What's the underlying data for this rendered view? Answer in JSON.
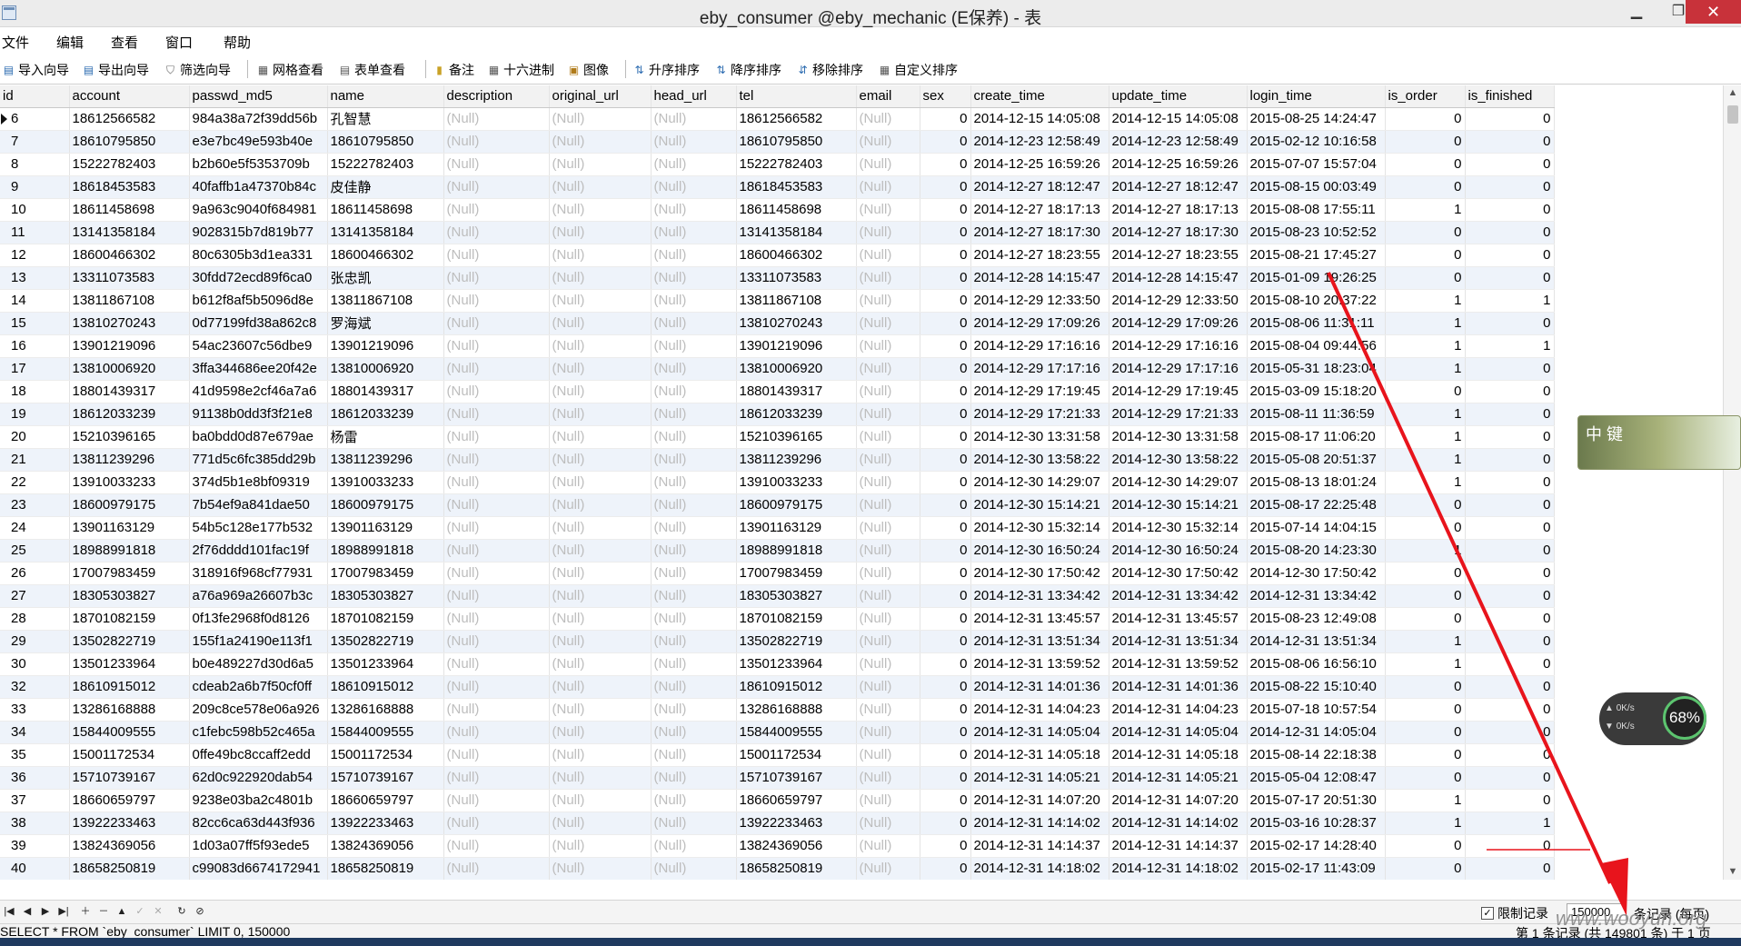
{
  "window": {
    "title": "eby_consumer @eby_mechanic (E保养) - 表"
  },
  "menu": [
    "文件",
    "编辑",
    "查看",
    "窗口",
    "帮助"
  ],
  "toolbar": [
    "导入向导",
    "导出向导",
    "筛选向导",
    "网格查看",
    "表单查看",
    "备注",
    "十六进制",
    "图像",
    "升序排序",
    "降序排序",
    "移除排序",
    "自定义排序"
  ],
  "columns": [
    "id",
    "account",
    "passwd_md5",
    "name",
    "description",
    "original_url",
    "head_url",
    "tel",
    "email",
    "sex",
    "create_time",
    "update_time",
    "login_time",
    "is_order",
    "is_finished"
  ],
  "null_text": "(Null)",
  "rows": [
    [
      "6",
      "18612566582",
      "984a38a72f39dd56b",
      "孔智慧",
      "(Null)",
      "(Null)",
      "(Null)",
      "18612566582",
      "(Null)",
      "0",
      "2014-12-15 14:05:08",
      "2014-12-15 14:05:08",
      "2015-08-25 14:24:47",
      "0",
      "0"
    ],
    [
      "7",
      "18610795850",
      "e3e7bc49e593b40e",
      "18610795850",
      "(Null)",
      "(Null)",
      "(Null)",
      "18610795850",
      "(Null)",
      "0",
      "2014-12-23 12:58:49",
      "2014-12-23 12:58:49",
      "2015-02-12 10:16:58",
      "0",
      "0"
    ],
    [
      "8",
      "15222782403",
      "b2b60e5f5353709b",
      "15222782403",
      "(Null)",
      "(Null)",
      "(Null)",
      "15222782403",
      "(Null)",
      "0",
      "2014-12-25 16:59:26",
      "2014-12-25 16:59:26",
      "2015-07-07 15:57:04",
      "0",
      "0"
    ],
    [
      "9",
      "18618453583",
      "40faffb1a47370b84c",
      "皮佳静",
      "(Null)",
      "(Null)",
      "(Null)",
      "18618453583",
      "(Null)",
      "0",
      "2014-12-27 18:12:47",
      "2014-12-27 18:12:47",
      "2015-08-15 00:03:49",
      "0",
      "0"
    ],
    [
      "10",
      "18611458698",
      "9a963c9040f684981",
      "18611458698",
      "(Null)",
      "(Null)",
      "(Null)",
      "18611458698",
      "(Null)",
      "0",
      "2014-12-27 18:17:13",
      "2014-12-27 18:17:13",
      "2015-08-08 17:55:11",
      "1",
      "0"
    ],
    [
      "11",
      "13141358184",
      "9028315b7d819b77",
      "13141358184",
      "(Null)",
      "(Null)",
      "(Null)",
      "13141358184",
      "(Null)",
      "0",
      "2014-12-27 18:17:30",
      "2014-12-27 18:17:30",
      "2015-08-23 10:52:52",
      "0",
      "0"
    ],
    [
      "12",
      "18600466302",
      "80c6305b3d1ea331",
      "18600466302",
      "(Null)",
      "(Null)",
      "(Null)",
      "18600466302",
      "(Null)",
      "0",
      "2014-12-27 18:23:55",
      "2014-12-27 18:23:55",
      "2015-08-21 17:45:27",
      "0",
      "0"
    ],
    [
      "13",
      "13311073583",
      "30fdd72ecd89f6ca0",
      "张忠凯",
      "(Null)",
      "(Null)",
      "(Null)",
      "13311073583",
      "(Null)",
      "0",
      "2014-12-28 14:15:47",
      "2014-12-28 14:15:47",
      "2015-01-09 19:26:25",
      "0",
      "0"
    ],
    [
      "14",
      "13811867108",
      "b612f8af5b5096d8e",
      "13811867108",
      "(Null)",
      "(Null)",
      "(Null)",
      "13811867108",
      "(Null)",
      "0",
      "2014-12-29 12:33:50",
      "2014-12-29 12:33:50",
      "2015-08-10 20:37:22",
      "1",
      "1"
    ],
    [
      "15",
      "13810270243",
      "0d77199fd38a862c8",
      "罗海斌",
      "(Null)",
      "(Null)",
      "(Null)",
      "13810270243",
      "(Null)",
      "0",
      "2014-12-29 17:09:26",
      "2014-12-29 17:09:26",
      "2015-08-06 11:31:11",
      "1",
      "0"
    ],
    [
      "16",
      "13901219096",
      "54ac23607c56dbe9",
      "13901219096",
      "(Null)",
      "(Null)",
      "(Null)",
      "13901219096",
      "(Null)",
      "0",
      "2014-12-29 17:16:16",
      "2014-12-29 17:16:16",
      "2015-08-04 09:44:56",
      "1",
      "1"
    ],
    [
      "17",
      "13810006920",
      "3ffa344686ee20f42e",
      "13810006920",
      "(Null)",
      "(Null)",
      "(Null)",
      "13810006920",
      "(Null)",
      "0",
      "2014-12-29 17:17:16",
      "2014-12-29 17:17:16",
      "2015-05-31 18:23:04",
      "1",
      "0"
    ],
    [
      "18",
      "18801439317",
      "41d9598e2cf46a7a6",
      "18801439317",
      "(Null)",
      "(Null)",
      "(Null)",
      "18801439317",
      "(Null)",
      "0",
      "2014-12-29 17:19:45",
      "2014-12-29 17:19:45",
      "2015-03-09 15:18:20",
      "0",
      "0"
    ],
    [
      "19",
      "18612033239",
      "91138b0dd3f3f21e8",
      "18612033239",
      "(Null)",
      "(Null)",
      "(Null)",
      "18612033239",
      "(Null)",
      "0",
      "2014-12-29 17:21:33",
      "2014-12-29 17:21:33",
      "2015-08-11 11:36:59",
      "1",
      "0"
    ],
    [
      "20",
      "15210396165",
      "ba0bdd0d87e679ae",
      "杨雷",
      "(Null)",
      "(Null)",
      "(Null)",
      "15210396165",
      "(Null)",
      "0",
      "2014-12-30 13:31:58",
      "2014-12-30 13:31:58",
      "2015-08-17 11:06:20",
      "1",
      "0"
    ],
    [
      "21",
      "13811239296",
      "771d5c6fc385dd29b",
      "13811239296",
      "(Null)",
      "(Null)",
      "(Null)",
      "13811239296",
      "(Null)",
      "0",
      "2014-12-30 13:58:22",
      "2014-12-30 13:58:22",
      "2015-05-08 20:51:37",
      "1",
      "0"
    ],
    [
      "22",
      "13910033233",
      "374d5b1e8bf09319",
      "13910033233",
      "(Null)",
      "(Null)",
      "(Null)",
      "13910033233",
      "(Null)",
      "0",
      "2014-12-30 14:29:07",
      "2014-12-30 14:29:07",
      "2015-08-13 18:01:24",
      "1",
      "0"
    ],
    [
      "23",
      "18600979175",
      "7b54ef9a841dae50",
      "18600979175",
      "(Null)",
      "(Null)",
      "(Null)",
      "18600979175",
      "(Null)",
      "0",
      "2014-12-30 15:14:21",
      "2014-12-30 15:14:21",
      "2015-08-17 22:25:48",
      "0",
      "0"
    ],
    [
      "24",
      "13901163129",
      "54b5c128e177b532",
      "13901163129",
      "(Null)",
      "(Null)",
      "(Null)",
      "13901163129",
      "(Null)",
      "0",
      "2014-12-30 15:32:14",
      "2014-12-30 15:32:14",
      "2015-07-14 14:04:15",
      "0",
      "0"
    ],
    [
      "25",
      "18988991818",
      "2f76dddd101fac19f",
      "18988991818",
      "(Null)",
      "(Null)",
      "(Null)",
      "18988991818",
      "(Null)",
      "0",
      "2014-12-30 16:50:24",
      "2014-12-30 16:50:24",
      "2015-08-20 14:23:30",
      "1",
      "0"
    ],
    [
      "26",
      "17007983459",
      "318916f968cf77931",
      "17007983459",
      "(Null)",
      "(Null)",
      "(Null)",
      "17007983459",
      "(Null)",
      "0",
      "2014-12-30 17:50:42",
      "2014-12-30 17:50:42",
      "2014-12-30 17:50:42",
      "0",
      "0"
    ],
    [
      "27",
      "18305303827",
      "a76a969a26607b3c",
      "18305303827",
      "(Null)",
      "(Null)",
      "(Null)",
      "18305303827",
      "(Null)",
      "0",
      "2014-12-31 13:34:42",
      "2014-12-31 13:34:42",
      "2014-12-31 13:34:42",
      "0",
      "0"
    ],
    [
      "28",
      "18701082159",
      "0f13fe2968f0d8126",
      "18701082159",
      "(Null)",
      "(Null)",
      "(Null)",
      "18701082159",
      "(Null)",
      "0",
      "2014-12-31 13:45:57",
      "2014-12-31 13:45:57",
      "2015-08-23 12:49:08",
      "0",
      "0"
    ],
    [
      "29",
      "13502822719",
      "155f1a24190e113f1",
      "13502822719",
      "(Null)",
      "(Null)",
      "(Null)",
      "13502822719",
      "(Null)",
      "0",
      "2014-12-31 13:51:34",
      "2014-12-31 13:51:34",
      "2014-12-31 13:51:34",
      "1",
      "0"
    ],
    [
      "30",
      "13501233964",
      "b0e489227d30d6a5",
      "13501233964",
      "(Null)",
      "(Null)",
      "(Null)",
      "13501233964",
      "(Null)",
      "0",
      "2014-12-31 13:59:52",
      "2014-12-31 13:59:52",
      "2015-08-06 16:56:10",
      "1",
      "0"
    ],
    [
      "32",
      "18610915012",
      "cdeab2a6b7f50cf0ff",
      "18610915012",
      "(Null)",
      "(Null)",
      "(Null)",
      "18610915012",
      "(Null)",
      "0",
      "2014-12-31 14:01:36",
      "2014-12-31 14:01:36",
      "2015-08-22 15:10:40",
      "0",
      "0"
    ],
    [
      "33",
      "13286168888",
      "209c8ce578e06a926",
      "13286168888",
      "(Null)",
      "(Null)",
      "(Null)",
      "13286168888",
      "(Null)",
      "0",
      "2014-12-31 14:04:23",
      "2014-12-31 14:04:23",
      "2015-07-18 10:57:54",
      "0",
      "0"
    ],
    [
      "34",
      "15844009555",
      "c1febc598b52c465a",
      "15844009555",
      "(Null)",
      "(Null)",
      "(Null)",
      "15844009555",
      "(Null)",
      "0",
      "2014-12-31 14:05:04",
      "2014-12-31 14:05:04",
      "2014-12-31 14:05:04",
      "0",
      "0"
    ],
    [
      "35",
      "15001172534",
      "0ffe49bc8ccaff2edd",
      "15001172534",
      "(Null)",
      "(Null)",
      "(Null)",
      "15001172534",
      "(Null)",
      "0",
      "2014-12-31 14:05:18",
      "2014-12-31 14:05:18",
      "2015-08-14 22:18:38",
      "0",
      "0"
    ],
    [
      "36",
      "15710739167",
      "62d0c922920dab54",
      "15710739167",
      "(Null)",
      "(Null)",
      "(Null)",
      "15710739167",
      "(Null)",
      "0",
      "2014-12-31 14:05:21",
      "2014-12-31 14:05:21",
      "2015-05-04 12:08:47",
      "0",
      "0"
    ],
    [
      "37",
      "18660659797",
      "9238e03ba2c4801b",
      "18660659797",
      "(Null)",
      "(Null)",
      "(Null)",
      "18660659797",
      "(Null)",
      "0",
      "2014-12-31 14:07:20",
      "2014-12-31 14:07:20",
      "2015-07-17 20:51:30",
      "1",
      "0"
    ],
    [
      "38",
      "13922233463",
      "82cc6ca63d443f936",
      "13922233463",
      "(Null)",
      "(Null)",
      "(Null)",
      "13922233463",
      "(Null)",
      "0",
      "2014-12-31 14:14:02",
      "2014-12-31 14:14:02",
      "2015-03-16 10:28:37",
      "1",
      "1"
    ],
    [
      "39",
      "13824369056",
      "1d03a07ff5f93ede5",
      "13824369056",
      "(Null)",
      "(Null)",
      "(Null)",
      "13824369056",
      "(Null)",
      "0",
      "2014-12-31 14:14:37",
      "2014-12-31 14:14:37",
      "2015-02-17 14:28:40",
      "0",
      "0"
    ],
    [
      "40",
      "18658250819",
      "c99083d6674172941",
      "18658250819",
      "(Null)",
      "(Null)",
      "(Null)",
      "18658250819",
      "(Null)",
      "0",
      "2014-12-31 14:18:02",
      "2014-12-31 14:18:02",
      "2015-02-17 11:43:09",
      "0",
      "0"
    ]
  ],
  "footer": {
    "limit_label": "限制记录",
    "limit_value": "150000",
    "per_page_label": "条记录 (每页)",
    "sql": "SELECT * FROM `eby_consumer` LIMIT 0, 150000",
    "record_info": "第 1 条记录 (共 149801 条) 于 1 页"
  },
  "overlays": {
    "widget_label": "中 键",
    "speed_up": "0K/s",
    "speed_down": "0K/s",
    "speed_percent": "68%",
    "watermark": "www.wooyun.org"
  },
  "colors": {
    "arrow": "#e8141c",
    "alt_row": "#eef3fa",
    "null_text": "#bdbdbd",
    "close_button": "#c8323a"
  }
}
